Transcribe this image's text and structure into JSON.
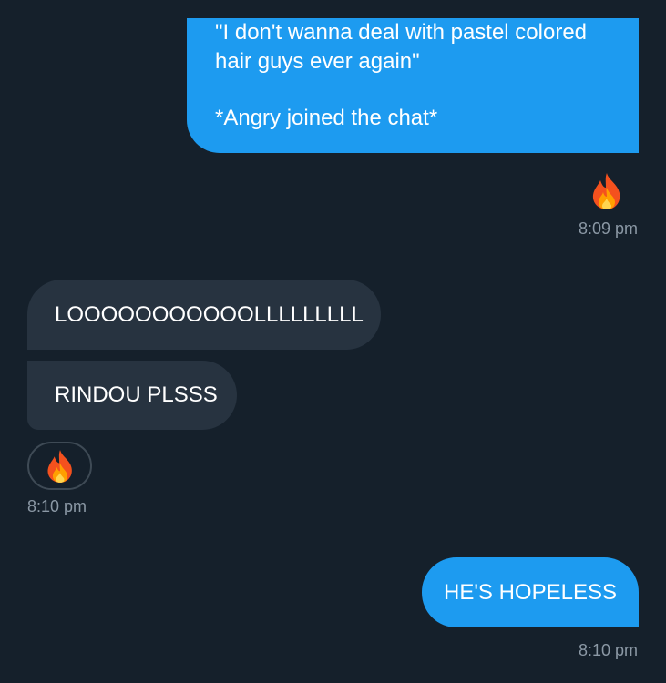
{
  "messages": {
    "out_top": {
      "line1": "\"I don't wanna deal with pastel colored",
      "line2": "hair guys ever again\"",
      "line3": "*Angry joined the chat*"
    },
    "out_top_reaction": {
      "icon": "fire-icon"
    },
    "out_top_time": "8:09 pm",
    "in_1": "LOOOOOOOOOOOLLLLLLLLL",
    "in_2": "RINDOU PLSSS",
    "in_reaction": {
      "icon": "fire-icon"
    },
    "in_time": "8:10 pm",
    "out_bottom": "HE'S HOPELESS",
    "out_bottom_time": "8:10 pm"
  },
  "colors": {
    "background": "#15202b",
    "outgoing_bubble": "#1d9bf0",
    "incoming_bubble": "#273340",
    "timestamp": "#8b98a5"
  }
}
